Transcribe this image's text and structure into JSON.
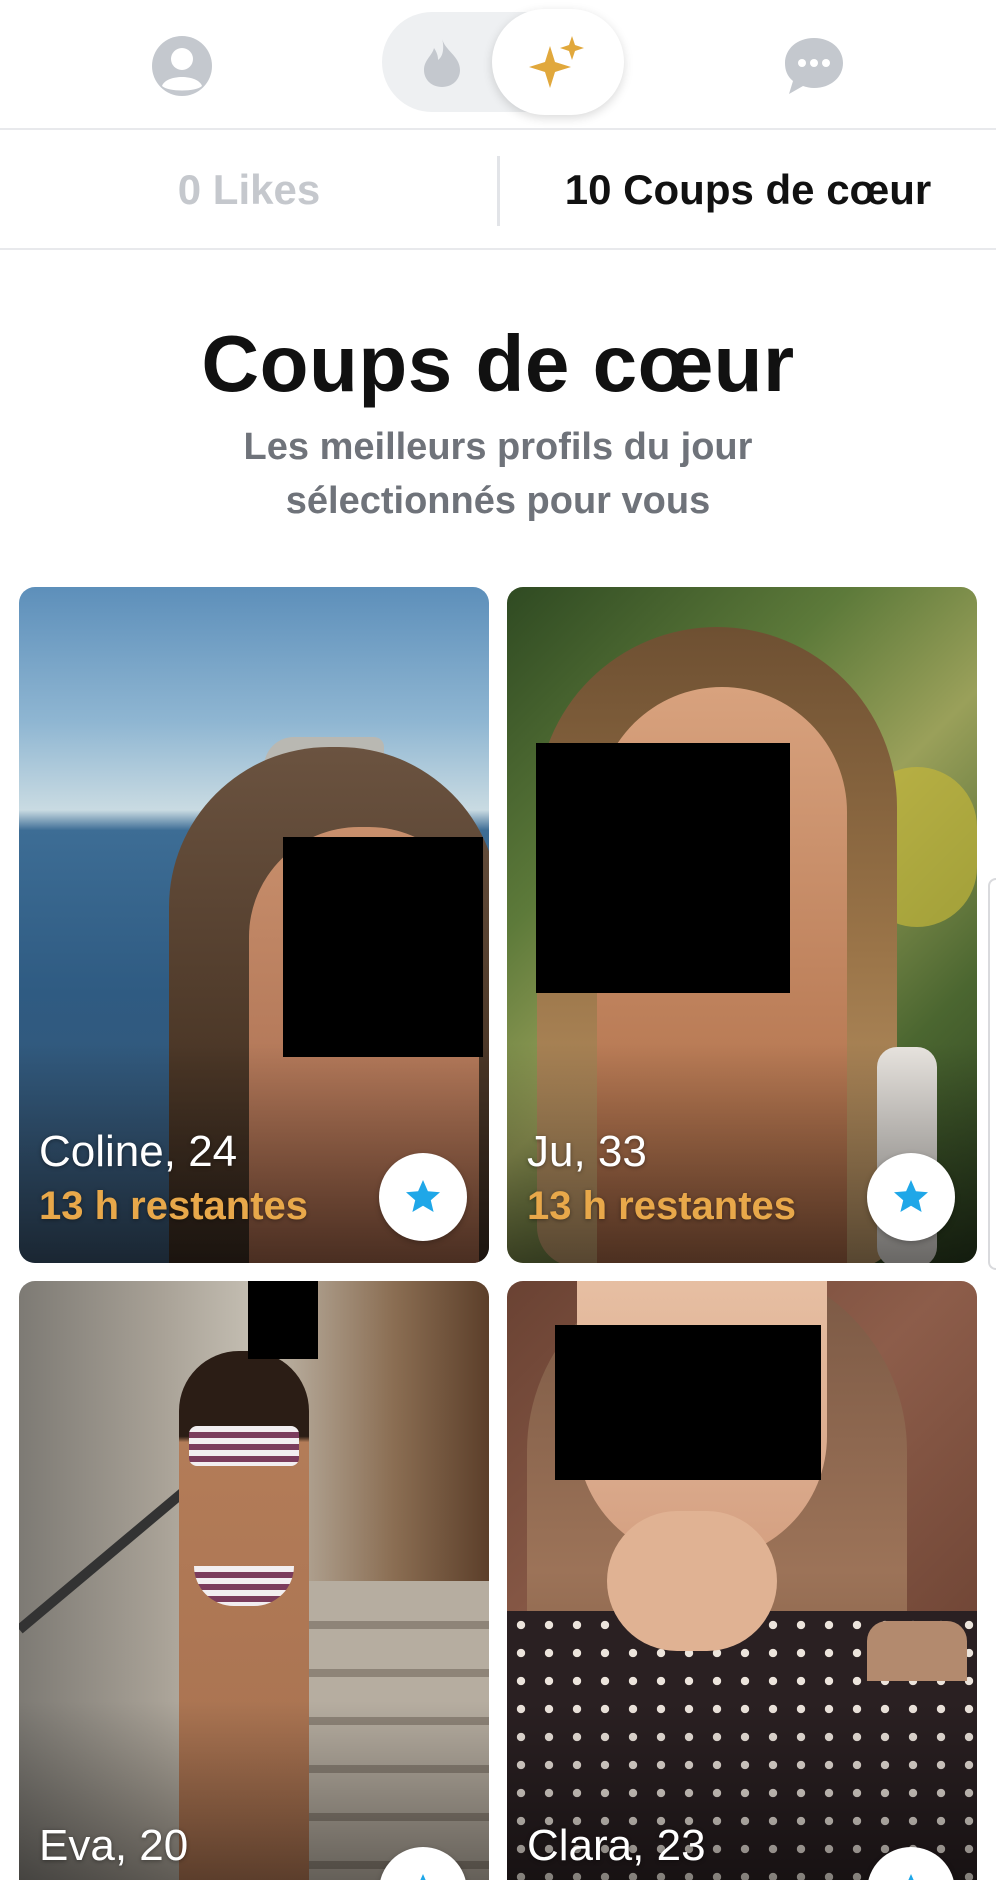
{
  "nav": {
    "profile_icon": "profile-icon",
    "flame_icon": "flame-icon",
    "sparkle_icon": "sparkle-icon",
    "chat_icon": "chat-icon",
    "colors": {
      "gold": "#E1A83C",
      "grey": "#C4C8CE"
    }
  },
  "tabs": {
    "likes_label": "0 Likes",
    "top_picks_label": "10 Coups de cœur"
  },
  "header": {
    "title": "Coups de cœur",
    "subtitle": "Les meilleurs profils du jour sélectionnés pour vous"
  },
  "cards": [
    {
      "name": "Coline, 24",
      "time_left": "13 h restantes"
    },
    {
      "name": "Ju, 33",
      "time_left": "13 h restantes"
    },
    {
      "name": "Eva, 20"
    },
    {
      "name": "Clara, 23"
    }
  ],
  "accent_colors": {
    "star_blue": "#1FA7E8",
    "time_orange": "#E8A84A"
  }
}
